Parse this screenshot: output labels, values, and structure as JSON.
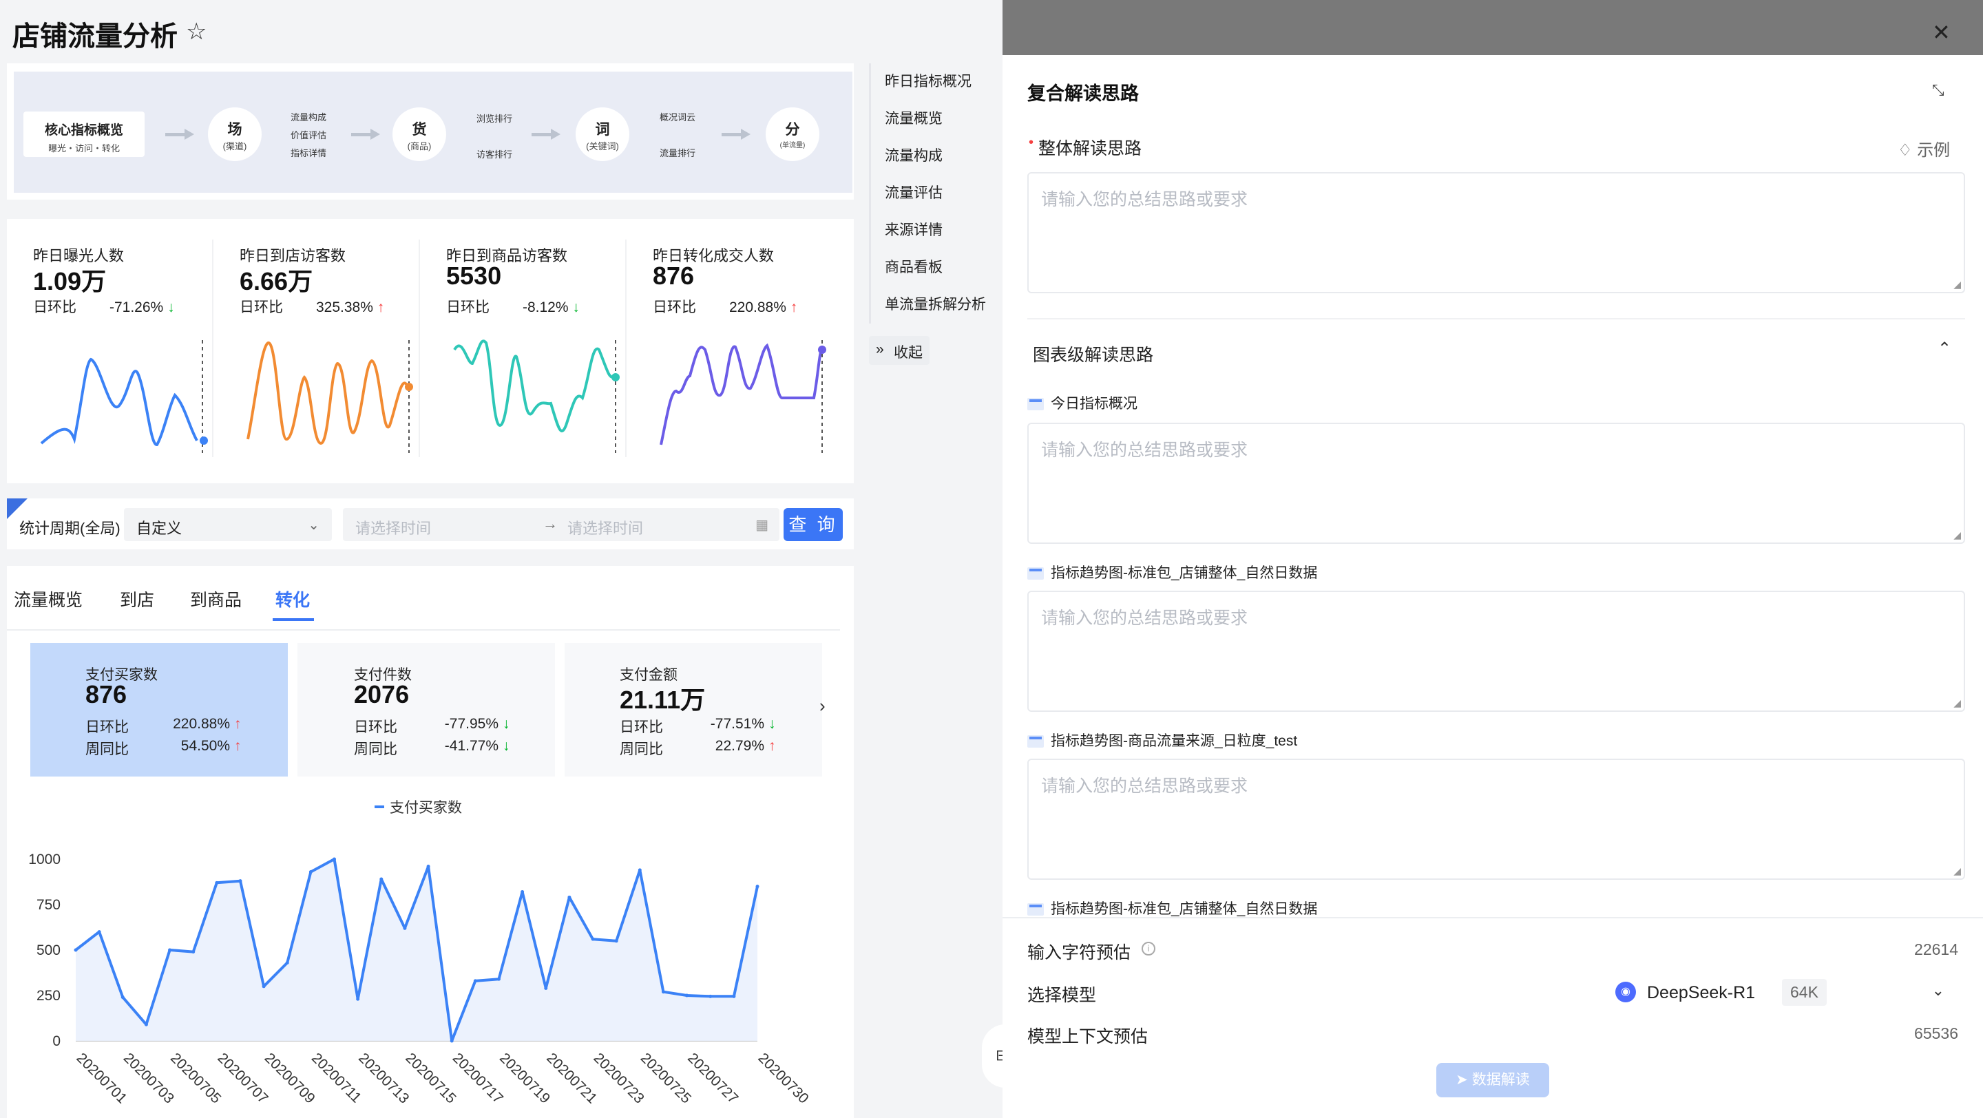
{
  "page": {
    "title": "店铺流量分析"
  },
  "flow": {
    "core_title": "核心指标概览",
    "core_sub": "曝光・访问・转化",
    "nodes": [
      {
        "main": "场",
        "sub": "(渠道)"
      },
      {
        "main": "货",
        "sub": "(商品)"
      },
      {
        "main": "词",
        "sub": "(关键词)"
      },
      {
        "main": "分",
        "sub": "(单流量)"
      }
    ],
    "chang_items": [
      "流量构成",
      "价值评估",
      "指标详情"
    ],
    "huo_items": [
      "浏览排行",
      "访客排行"
    ],
    "ci_items": [
      "概况词云",
      "流量排行"
    ]
  },
  "metrics": [
    {
      "label": "昨日曝光人数",
      "value": "1.09万",
      "cmp_label": "日环比",
      "cmp_value": "-71.26%",
      "dir": "down",
      "color": "#3b82f6"
    },
    {
      "label": "昨日到店访客数",
      "value": "6.66万",
      "cmp_label": "日环比",
      "cmp_value": "325.38%",
      "dir": "up",
      "color": "#f28b32"
    },
    {
      "label": "昨日到商品访客数",
      "value": "5530",
      "cmp_label": "日环比",
      "cmp_value": "-8.12%",
      "dir": "down",
      "color": "#2ec7b7"
    },
    {
      "label": "昨日转化成交人数",
      "value": "876",
      "cmp_label": "日环比",
      "cmp_value": "220.88%",
      "dir": "up",
      "color": "#6b5ce7"
    }
  ],
  "filter": {
    "label": "统计周期(全局)",
    "period_value": "自定义",
    "start_placeholder": "请选择时间",
    "end_placeholder": "请选择时间",
    "query_label": "查 询"
  },
  "tabs": [
    {
      "label": "流量概览",
      "active": false
    },
    {
      "label": "到店",
      "active": false
    },
    {
      "label": "到商品",
      "active": false
    },
    {
      "label": "转化",
      "active": true
    }
  ],
  "kpis": [
    {
      "label": "支付买家数",
      "value": "876",
      "r1_label": "日环比",
      "r1_value": "220.88%",
      "r1_dir": "up",
      "r2_label": "周同比",
      "r2_value": "54.50%",
      "r2_dir": "up",
      "selected": true
    },
    {
      "label": "支付件数",
      "value": "2076",
      "r1_label": "日环比",
      "r1_value": "-77.95%",
      "r1_dir": "down",
      "r2_label": "周同比",
      "r2_value": "-41.77%",
      "r2_dir": "down",
      "selected": false
    },
    {
      "label": "支付金额",
      "value": "21.11万",
      "r1_label": "日环比",
      "r1_value": "-77.51%",
      "r1_dir": "down",
      "r2_label": "周同比",
      "r2_value": "22.79%",
      "r2_dir": "up",
      "selected": false
    }
  ],
  "chart_data": {
    "type": "area",
    "title": "",
    "xlabel": "",
    "ylabel": "",
    "legend": "top-center",
    "ylim": [
      0,
      1000
    ],
    "yticks": [
      0,
      250,
      500,
      750,
      1000
    ],
    "x_tick_labels": [
      "20200701",
      "20200703",
      "20200705",
      "20200707",
      "20200709",
      "20200711",
      "20200713",
      "20200715",
      "20200717",
      "20200719",
      "20200721",
      "20200723",
      "20200725",
      "20200727",
      "20200730"
    ],
    "x": [
      "20200701",
      "20200702",
      "20200703",
      "20200704",
      "20200705",
      "20200706",
      "20200707",
      "20200708",
      "20200709",
      "20200710",
      "20200711",
      "20200712",
      "20200713",
      "20200714",
      "20200715",
      "20200716",
      "20200717",
      "20200718",
      "20200719",
      "20200720",
      "20200721",
      "20200722",
      "20200723",
      "20200724",
      "20200725",
      "20200726",
      "20200727",
      "20200728",
      "20200729",
      "20200730"
    ],
    "series": [
      {
        "name": "支付买家数",
        "color": "#3b82f6",
        "values": [
          500,
          600,
          240,
          90,
          500,
          490,
          870,
          880,
          300,
          430,
          930,
          1000,
          230,
          890,
          620,
          960,
          0,
          330,
          340,
          820,
          290,
          790,
          560,
          550,
          940,
          270,
          250,
          245,
          245,
          850
        ]
      }
    ]
  },
  "side_nav": {
    "items": [
      "昨日指标概况",
      "流量概览",
      "流量构成",
      "流量评估",
      "来源详情",
      "商品看板",
      "单流量拆解分析"
    ],
    "collapse_label": "收起"
  },
  "drawer": {
    "title": "复合解读思路",
    "overall_label": "整体解读思路",
    "example_label": "示例",
    "placeholder": "请输入您的总结思路或要求",
    "chart_section_label": "图表级解读思路",
    "chart_items": [
      "今日指标概况",
      "指标趋势图-标准包_店铺整体_自然日数据",
      "指标趋势图-商品流量来源_日粒度_test",
      "指标趋势图-标准包_店铺整体_自然日数据"
    ],
    "input_chars_label": "输入字符预估",
    "input_chars_value": "22614",
    "model_label": "选择模型",
    "model_name": "DeepSeek-R1",
    "model_tag": "64K",
    "context_label": "模型上下文预估",
    "context_value": "65536",
    "analyze_label": "数据解读"
  }
}
